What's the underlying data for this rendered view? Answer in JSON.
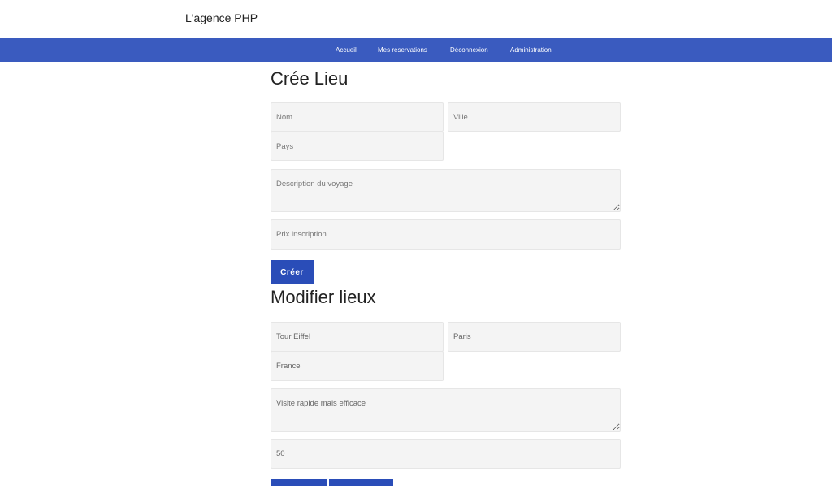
{
  "brand": "L'agence PHP",
  "nav": {
    "items": [
      {
        "label": "Accueil"
      },
      {
        "label": "Mes reservations"
      },
      {
        "label": "Déconnexion"
      },
      {
        "label": "Administration"
      }
    ]
  },
  "create_form": {
    "title": "Crée Lieu",
    "nom_placeholder": "Nom",
    "ville_placeholder": "Ville",
    "pays_placeholder": "Pays",
    "description_placeholder": "Description du voyage",
    "prix_placeholder": "Prix inscription",
    "submit_label": "Créer"
  },
  "edit_form": {
    "title": "Modifier lieux",
    "nom_value": "Tour Eiffel",
    "ville_value": "Paris",
    "pays_value": "France",
    "description_value": "Visite rapide mais efficace",
    "prix_value": "50"
  },
  "colors": {
    "navbar": "#3a5bbf",
    "button": "#2a4db8"
  }
}
